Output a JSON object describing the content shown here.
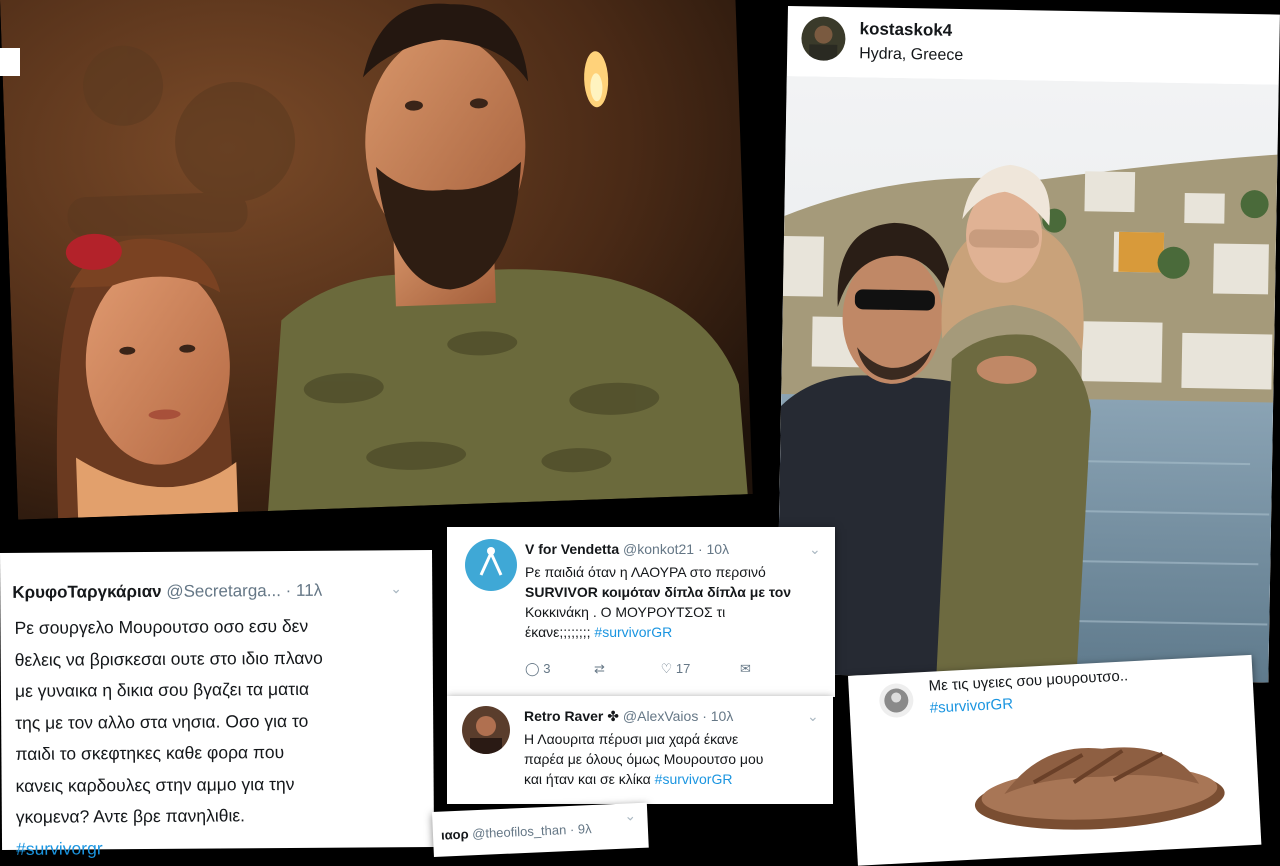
{
  "photo_left": {
    "corner_mark": ""
  },
  "instagram": {
    "username": "kostaskok4",
    "location": "Hydra, Greece"
  },
  "tweet_left": {
    "name": "ΚρυφοΤαργκάριαν",
    "handle": "@Secretarga...",
    "time": "· 11λ",
    "line1": "Ρε σουργελο Μουρουτσο οσο εσυ δεν",
    "line2": "θελεις να βρισκεσαι ουτε στο ιδιο πλανο",
    "line3": "με γυναικα η δικια σου βγαζει τα ματια",
    "line4": "της με τον αλλο στα νησια. Οσο για το",
    "line5": "παιδι το σκεφτηκες καθε φορα που",
    "line6": "κανεις καρδουλες στην αμμο για την",
    "line7": "γκομενα? Αντε βρε πανηλιθιε.",
    "hashtag": "#survivorgr"
  },
  "tweet_vendetta": {
    "name": "V for Vendetta",
    "handle": "@konkot21",
    "time": "· 10λ",
    "line1": "Ρε παιδιά όταν η ΛΑΟΥΡΑ στο περσινό",
    "line2": "SURVIVOR κοιμόταν δίπλα δίπλα με τον",
    "line3": "Κοκκινάκη . Ο ΜΟΥΡΟΥΤΣΟΣ τι",
    "line4": "έκανε;;;;;;;;",
    "hashtag": "#survivorGR",
    "replies": "3",
    "retweets": "",
    "likes": "17"
  },
  "tweet_retro": {
    "name": "Retro Raver",
    "handle": "@AlexVaios",
    "time": "· 10λ",
    "line1": "Η Λαουριτα πέρυσι μια χαρά έκανε",
    "line2": "παρέα με όλους όμως Μουρουτσο μου",
    "line3": "και ήταν και σε κλίκα",
    "hashtag": "#survivorGR"
  },
  "tweet_bottom": {
    "handle": "@theofilos_than",
    "time": "· 9λ",
    "name_partial": "ιαορ"
  },
  "tweet_slipper": {
    "line1": "Με τις υγειες σου μουρουτσο..",
    "hashtag": "#survivorGR"
  },
  "colors": {
    "twitter_blue": "#1b95e0",
    "background": "#000000"
  }
}
